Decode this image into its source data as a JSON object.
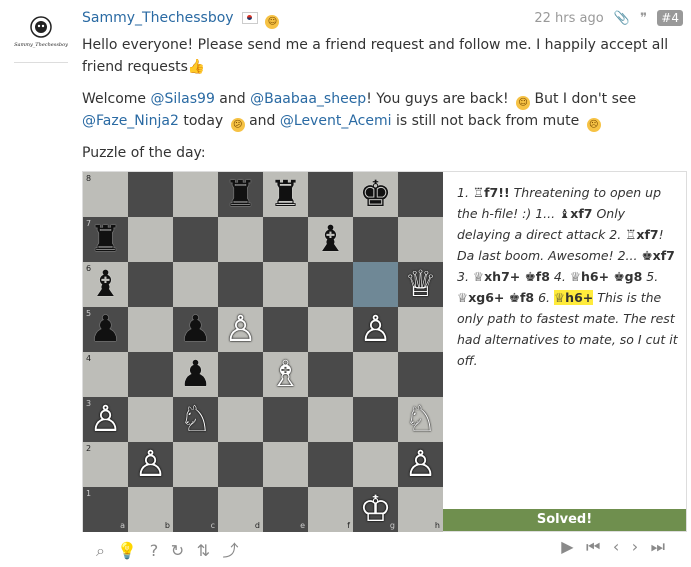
{
  "post": {
    "avatar_text": "Sammy_Thechessboy",
    "username": "Sammy_Thechessboy",
    "time": "22 hrs ago",
    "post_number": "#4",
    "paragraphs": {
      "p1": "Hello everyone! Please send me a friend request and follow me. I happily accept all friend requests",
      "p2_a": "Welcome ",
      "p2_m1": "@Silas99",
      "p2_b": " and ",
      "p2_m2": "@Baabaa_sheep",
      "p2_c": "! You guys are back! ",
      "p2_d": " But I don't see ",
      "p2_m3": "@Faze_Ninja2",
      "p2_e": " today ",
      "p2_f": " and ",
      "p2_m4": "@Levent_Acemi",
      "p2_g": " is still not back from mute ",
      "p3": "Puzzle of the day:"
    }
  },
  "puzzle": {
    "board": [
      [
        "",
        "",
        "",
        "bk_q",
        "br",
        "",
        "bk",
        ""
      ],
      [
        "br",
        "",
        "",
        "",
        "",
        "bb",
        "",
        ""
      ],
      [
        "bb",
        "",
        "",
        "",
        "",
        "",
        "",
        "wq"
      ],
      [
        "bp",
        "",
        "bp",
        "wp",
        "",
        "",
        "wp",
        ""
      ],
      [
        "",
        "",
        "bp",
        "",
        "wb",
        "",
        "",
        ""
      ],
      [
        "wp",
        "",
        "wn",
        "",
        "",
        "",
        "",
        "wn"
      ],
      [
        "",
        "wp",
        "",
        "",
        "",
        "",
        "",
        "wp"
      ],
      [
        "",
        "",
        "",
        "",
        "",
        "",
        "wk",
        ""
      ]
    ],
    "files": [
      "a",
      "b",
      "c",
      "d",
      "e",
      "f",
      "g",
      "h"
    ],
    "ranks": [
      "8",
      "7",
      "6",
      "5",
      "4",
      "3",
      "2",
      "1"
    ],
    "moves_text": {
      "m1": "1. ",
      "m1_move": "♖f7!!",
      "m1_note": " Threatening to open up the h-file! :) 1... ",
      "m2_move": "♝xf7",
      "m2_note": " Only delaying a direct attack 2. ",
      "m3_move": "♖xf7",
      "m3_note": "! Da last boom. Awesome! 2... ",
      "m4_move": "♚xf7",
      "m4_note": " 3. ",
      "m5_move": "♕xh7+ ♚f8",
      "m5_note": " 4. ",
      "m6_move": "♕h6+ ♚g8",
      "m6_note": " 5. ",
      "m7_move": "♕xg6+ ♚f8",
      "m7_note": " 6. ",
      "m8_move": "♕h6+",
      "m8_note": " This is the only path to fastest mate. The rest had alternatives to mate, so I cut it off."
    },
    "status": "Solved!"
  }
}
